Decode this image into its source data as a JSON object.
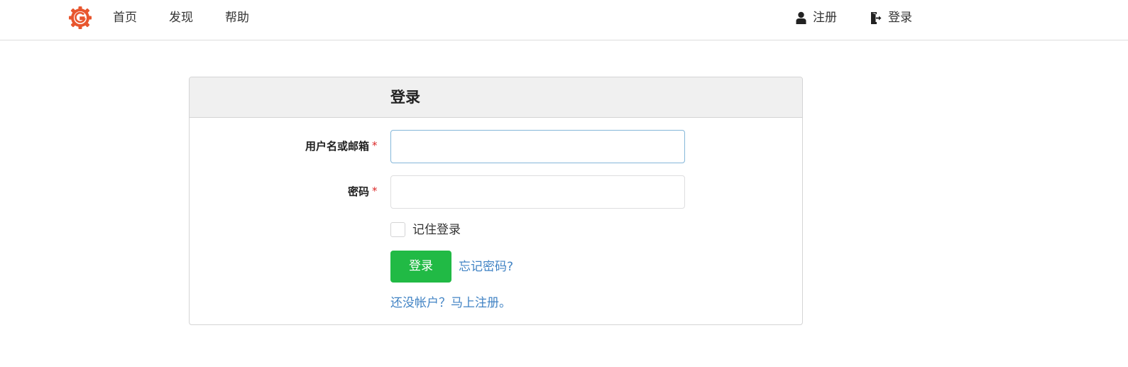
{
  "navbar": {
    "logo_icon": "gitea-gear-logo",
    "items": [
      {
        "label": "首页"
      },
      {
        "label": "发现"
      },
      {
        "label": "帮助"
      }
    ],
    "register": {
      "label": "注册",
      "icon": "user-icon"
    },
    "login": {
      "label": "登录",
      "icon": "sign-in-icon"
    }
  },
  "login_form": {
    "title": "登录",
    "username": {
      "label": "用户名或邮箱",
      "required_mark": "*",
      "value": "",
      "placeholder": ""
    },
    "password": {
      "label": "密码",
      "required_mark": "*",
      "value": "",
      "placeholder": ""
    },
    "remember_me": {
      "label": "记住登录",
      "checked": false
    },
    "submit_label": "登录",
    "forgot_password": "忘记密码?",
    "register_prompt": "还没帐户？马上注册。"
  },
  "colors": {
    "primary_green": "#21ba45",
    "link_blue": "#4183c4",
    "required_red": "#db2828",
    "logo_orange": "#e8562e"
  }
}
